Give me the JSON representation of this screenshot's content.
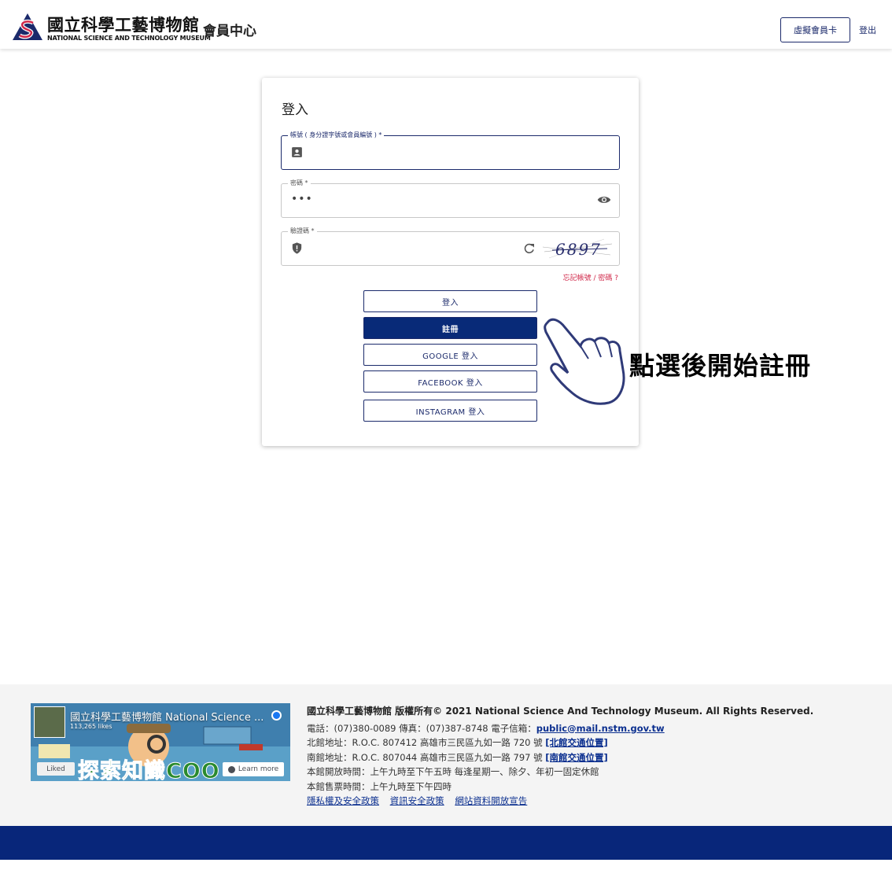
{
  "header": {
    "logo_zh": "國立科學工藝博物館",
    "logo_en": "NATIONAL SCIENCE AND TECHNOLOGY MUSEUM",
    "subtitle": "會員中心",
    "vcard_button": "虛擬會員卡",
    "logout": "登出"
  },
  "login": {
    "title": "登入",
    "account_label": "帳號 ( 身分證字號或會員編號 ) *",
    "password_label": "密碼 *",
    "password_value": "•••",
    "captcha_label": "驗證碼 *",
    "captcha_text": "6897",
    "forgot": "忘記帳號 / 密碼 ?",
    "btn_login": "登入",
    "btn_register": "註冊",
    "btn_google": "GOOGLE 登入",
    "btn_facebook": "FACEBOOK 登入",
    "btn_instagram": "INSTAGRAM 登入"
  },
  "annotation": {
    "text": "點選後開始註冊"
  },
  "footer": {
    "fb_name": "國立科學工藝博物館 National Science ...",
    "fb_likes": "113,265 likes",
    "fb_liked": "Liked",
    "fb_learn_more": "Learn more",
    "fb_banner": "探索知識COO",
    "copyright": "國立科學工藝博物館 版權所有© 2021 National Science And Technology Museum. All Rights Reserved.",
    "contact_prefix": "電話：(07)380-0089  傳真：(07)387-8748  電子信箱：",
    "email": "public@mail.nstm.gov.tw",
    "north_prefix": "北館地址：R.O.C. 807412 高雄市三民區九如一路 720 號 ",
    "north_link": "[北館交通位置]",
    "south_prefix": "南館地址：R.O.C. 807044 高雄市三民區九如一路 797 號 ",
    "south_link": "[南館交通位置]",
    "hours": "本館開放時間：上午九時至下午五時 每逢星期一、除夕、年初一固定休館",
    "ticket_hours": "本館售票時間：上午九時至下午四時",
    "link_privacy": "隱私權及安全政策",
    "link_security": "資訊安全政策",
    "link_open_data": "網站資料開放宣告"
  },
  "colors": {
    "primary": "#082a78",
    "accent": "#d0284a",
    "footer_bg": "#f4f4f4"
  }
}
